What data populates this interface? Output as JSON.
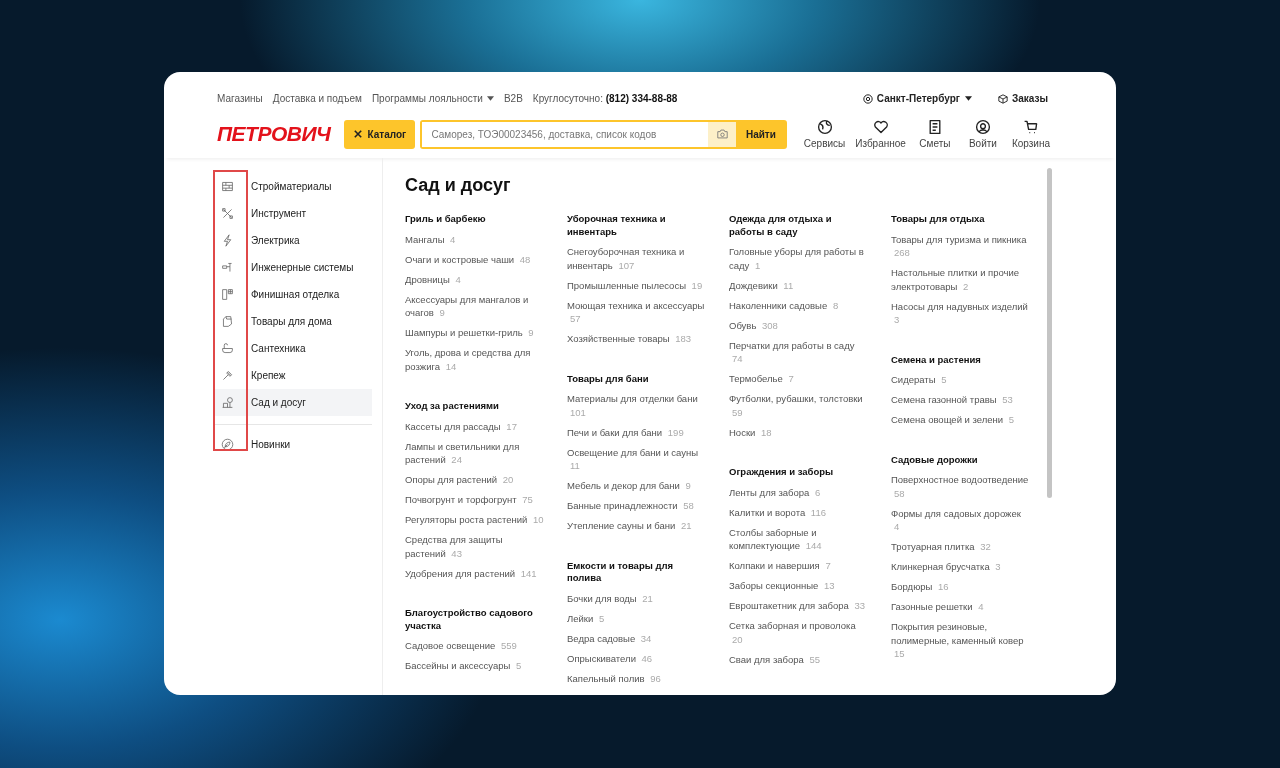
{
  "top_links": [
    {
      "label": "Магазины",
      "has_menu": false
    },
    {
      "label": "Доставка и подъем",
      "has_menu": false
    },
    {
      "label": "Программы лояльности",
      "has_menu": true
    },
    {
      "label": "B2B",
      "has_menu": false
    }
  ],
  "hotline": "Круглосуточно: **(812) 334-88-88**",
  "city": "Санкт-Петербург",
  "orders": "Заказы",
  "logo": "ПЕТРОВИЧ",
  "catalog_button": "Каталог",
  "search": {
    "placeholder": "Саморез, ТОЭ00023456, доставка, список кодов"
  },
  "search_button": "Найти",
  "nav": [
    {
      "label": "Сервисы"
    },
    {
      "label": "Избранное"
    },
    {
      "label": "Сметы"
    },
    {
      "label": "Войти"
    },
    {
      "label": "Корзина"
    }
  ],
  "sidebar": {
    "categories": [
      {
        "label": "Стройматериалы",
        "selected": false
      },
      {
        "label": "Инструмент",
        "selected": false
      },
      {
        "label": "Электрика",
        "selected": false
      },
      {
        "label": "Инженерные системы",
        "selected": false
      },
      {
        "label": "Финишная отделка",
        "selected": false
      },
      {
        "label": "Товары для дома",
        "selected": false
      },
      {
        "label": "Сантехника",
        "selected": false
      },
      {
        "label": "Крепеж",
        "selected": false
      },
      {
        "label": "Сад и досуг",
        "selected": true
      }
    ],
    "extra": "Новинки"
  },
  "page_title": "Сад и досуг",
  "columns": [
    [
      {
        "title": "Гриль и барбекю",
        "items": [
          {
            "name": "Мангалы",
            "count": "4"
          },
          {
            "name": "Очаги и костровые чаши",
            "count": "48"
          },
          {
            "name": "Дровницы",
            "count": "4"
          },
          {
            "name": "Аксессуары для мангалов и очагов",
            "count": "9"
          },
          {
            "name": "Шампуры и решетки-гриль",
            "count": "9"
          },
          {
            "name": "Уголь, дрова и средства для розжига",
            "count": "14"
          }
        ]
      },
      {
        "title": "Уход за растениями",
        "items": [
          {
            "name": "Кассеты для рассады",
            "count": "17"
          },
          {
            "name": "Лампы и светильники для растений",
            "count": "24"
          },
          {
            "name": "Опоры для растений",
            "count": "20"
          },
          {
            "name": "Почвогрунт и торфогрунт",
            "count": "75"
          },
          {
            "name": "Регуляторы роста растений",
            "count": "10"
          },
          {
            "name": "Средства для защиты растений",
            "count": "43"
          },
          {
            "name": "Удобрения для растений",
            "count": "141"
          }
        ]
      },
      {
        "title": "Благоустройство садового участка",
        "items": [
          {
            "name": "Садовое освещение",
            "count": "559"
          },
          {
            "name": "Бассейны и аксессуары",
            "count": "5"
          }
        ]
      }
    ],
    [
      {
        "title": "Уборочная техника и инвентарь",
        "items": [
          {
            "name": "Снегоуборочная техника и инвентарь",
            "count": "107"
          },
          {
            "name": "Промышленные пылесосы",
            "count": "19"
          },
          {
            "name": "Моющая техника и аксессуары",
            "count": "57"
          },
          {
            "name": "Хозяйственные товары",
            "count": "183"
          }
        ]
      },
      {
        "title": "Товары для бани",
        "items": [
          {
            "name": "Материалы для отделки бани",
            "count": "101"
          },
          {
            "name": "Печи и баки для бани",
            "count": "199"
          },
          {
            "name": "Освещение для бани и сауны",
            "count": "11"
          },
          {
            "name": "Мебель и декор для бани",
            "count": "9"
          },
          {
            "name": "Банные принадлежности",
            "count": "58"
          },
          {
            "name": "Утепление сауны и бани",
            "count": "21"
          }
        ]
      },
      {
        "title": "Емкости и товары для полива",
        "items": [
          {
            "name": "Бочки для воды",
            "count": "21"
          },
          {
            "name": "Лейки",
            "count": "5"
          },
          {
            "name": "Ведра садовые",
            "count": "34"
          },
          {
            "name": "Опрыскиватели",
            "count": "46"
          },
          {
            "name": "Капельный полив",
            "count": "96"
          }
        ]
      }
    ],
    [
      {
        "title": "Одежда для отдыха и работы в саду",
        "items": [
          {
            "name": "Головные уборы для работы в саду",
            "count": "1"
          },
          {
            "name": "Дождевики",
            "count": "11"
          },
          {
            "name": "Наколенники садовые",
            "count": "8"
          },
          {
            "name": "Обувь",
            "count": "308"
          },
          {
            "name": "Перчатки для работы в саду",
            "count": "74"
          },
          {
            "name": "Термобелье",
            "count": "7"
          },
          {
            "name": "Футболки, рубашки, толстовки",
            "count": "59"
          },
          {
            "name": "Носки",
            "count": "18"
          }
        ]
      },
      {
        "title": "Ограждения и заборы",
        "items": [
          {
            "name": "Ленты для забора",
            "count": "6"
          },
          {
            "name": "Калитки и ворота",
            "count": "116"
          },
          {
            "name": "Столбы заборные и комплектующие",
            "count": "144"
          },
          {
            "name": "Колпаки и навершия",
            "count": "7"
          },
          {
            "name": "Заборы секционные",
            "count": "13"
          },
          {
            "name": "Евроштакетник для забора",
            "count": "33"
          },
          {
            "name": "Сетка заборная и проволока",
            "count": "20"
          },
          {
            "name": "Сваи для забора",
            "count": "55"
          }
        ]
      }
    ],
    [
      {
        "title": "Товары для отдыха",
        "items": [
          {
            "name": "Товары для туризма и пикника",
            "count": "268"
          },
          {
            "name": "Настольные плитки и прочие электротовары",
            "count": "2"
          },
          {
            "name": "Насосы для надувных изделий",
            "count": "3"
          }
        ]
      },
      {
        "title": "Семена и растения",
        "items": [
          {
            "name": "Сидераты",
            "count": "5"
          },
          {
            "name": "Семена газонной травы",
            "count": "53"
          },
          {
            "name": "Семена овощей и зелени",
            "count": "5"
          }
        ]
      },
      {
        "title": "Садовые дорожки",
        "items": [
          {
            "name": "Поверхностное водоотведение",
            "count": "58"
          },
          {
            "name": "Формы для садовых дорожек",
            "count": "4"
          },
          {
            "name": "Тротуарная плитка",
            "count": "32"
          },
          {
            "name": "Клинкерная брусчатка",
            "count": "3"
          },
          {
            "name": "Бордюры",
            "count": "16"
          },
          {
            "name": "Газонные решетки",
            "count": "4"
          },
          {
            "name": "Покрытия резиновые, полимерные, каменный ковер",
            "count": "15"
          }
        ]
      }
    ]
  ]
}
